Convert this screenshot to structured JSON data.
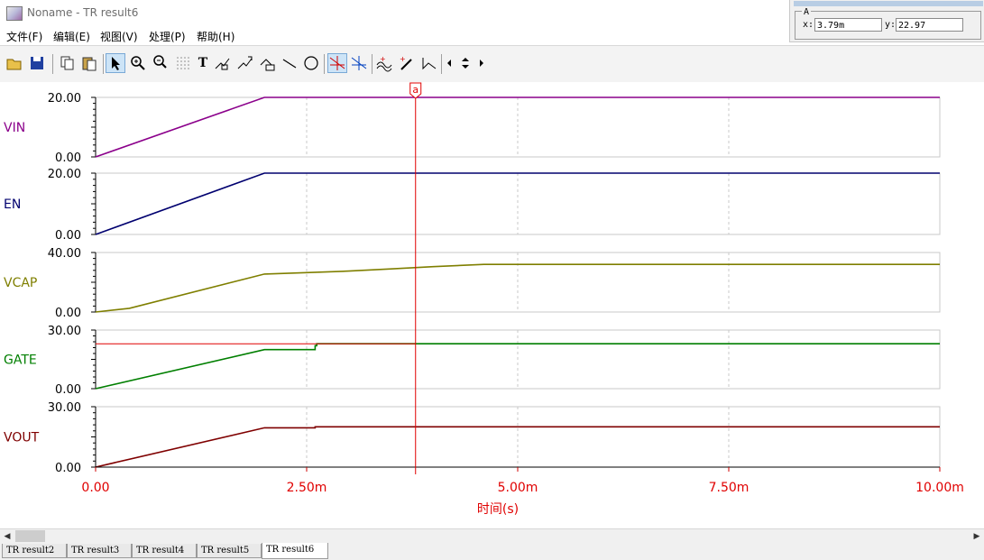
{
  "window": {
    "title": "Noname - TR result6",
    "menu": [
      "文件(F)",
      "编辑(E)",
      "视图(V)",
      "处理(P)",
      "帮助(H)"
    ]
  },
  "toolbar": {
    "icons": [
      "open-icon",
      "save-icon",
      "copy-icon",
      "paste-icon",
      "pointer-icon",
      "zoom-in-icon",
      "zoom-100-icon",
      "grid-icon",
      "text-icon",
      "label-icon",
      "marker-icon",
      "axis-label-icon",
      "line-icon",
      "circle-icon",
      "cursor-a-icon",
      "cursor-b-icon",
      "waveform-icon",
      "probe-icon",
      "step-icon",
      "arrow-left-icon",
      "arrow-up-down-icon",
      "arrow-right-icon"
    ],
    "text_glyph": "T"
  },
  "cursor_panel": {
    "group_label": "A",
    "x_label": "x:",
    "x_value": "3.79m",
    "y_label": "y:",
    "y_value": "22.97"
  },
  "tabs": [
    "TR result2",
    "TR result3",
    "TR result4",
    "TR result5",
    "TR result6"
  ],
  "active_tab": 4,
  "chart_data": {
    "type": "line",
    "x_unit": "s",
    "xlabel": "时间(s)",
    "xlim": [
      0,
      0.01
    ],
    "xticks": [
      {
        "v": 0,
        "label": "0.00"
      },
      {
        "v": 0.0025,
        "label": "2.50m"
      },
      {
        "v": 0.005,
        "label": "5.00m"
      },
      {
        "v": 0.0075,
        "label": "7.50m"
      },
      {
        "v": 0.01,
        "label": "10.00m"
      }
    ],
    "grid": true,
    "cursor": {
      "name": "a",
      "x": 0.00379,
      "y": 22.97,
      "panel": "GATE",
      "color": "#e00000"
    },
    "panels": [
      {
        "name": "VIN",
        "color": "#8b008b",
        "ylim": [
          0,
          20
        ],
        "ytick_labels": [
          "20.00",
          "0.00"
        ],
        "x": [
          0,
          0.002,
          0.01
        ],
        "y": [
          0,
          20,
          20
        ]
      },
      {
        "name": "EN",
        "color": "#00006f",
        "ylim": [
          0,
          20
        ],
        "ytick_labels": [
          "20.00",
          "0.00"
        ],
        "x": [
          0,
          0.002,
          0.01
        ],
        "y": [
          0,
          20,
          20
        ]
      },
      {
        "name": "VCAP",
        "color": "#7f7f00",
        "ylim": [
          0,
          40
        ],
        "ytick_labels": [
          "40.00",
          "0.00"
        ],
        "x": [
          0,
          0.0004,
          0.002,
          0.0025,
          0.003,
          0.0035,
          0.004,
          0.0046,
          0.01
        ],
        "y": [
          0,
          2.5,
          25.5,
          26.5,
          27.5,
          29,
          30.5,
          32,
          32
        ]
      },
      {
        "name": "GATE",
        "color": "#007f00",
        "ylim": [
          0,
          30
        ],
        "ytick_labels": [
          "30.00",
          "0.00"
        ],
        "x": [
          0,
          0.002,
          0.0026,
          0.0026,
          0.00262,
          0.00262,
          0.01
        ],
        "y": [
          0,
          20,
          20,
          22,
          22,
          23,
          23
        ]
      },
      {
        "name": "VOUT",
        "color": "#7f0000",
        "ylim": [
          0,
          30
        ],
        "ytick_labels": [
          "30.00",
          "0.00"
        ],
        "x": [
          0,
          0.002,
          0.0026,
          0.0026,
          0.01
        ],
        "y": [
          0,
          19.5,
          19.5,
          20,
          20
        ]
      }
    ]
  }
}
